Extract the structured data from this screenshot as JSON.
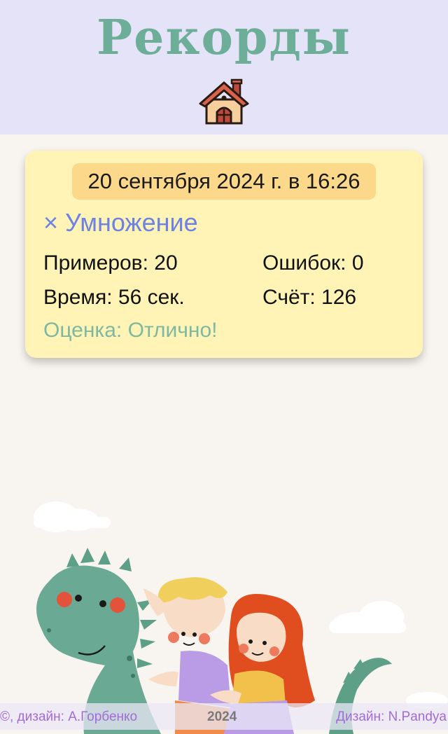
{
  "header": {
    "title": "Рекорды",
    "home_icon": "house-icon"
  },
  "record": {
    "date": "20 сентября 2024 г. в 16:26",
    "operation_symbol": "×",
    "operation_name": "Умножение",
    "examples_label": "Примеров: 20",
    "errors_label": "Ошибок: 0",
    "time_label": "Время: 56 сек.",
    "score_label": "Счёт: 126",
    "grade_label": "Оценка: Отлично!"
  },
  "footer": {
    "left": "©, дизайн:  А.Горбенко",
    "year": "2024",
    "right": "Дизайн:  N.Pandya"
  },
  "colors": {
    "header_bg": "#e5e3f7",
    "title": "#6cae98",
    "card_bg": "#fff3b6",
    "date_chip": "#fcd98a",
    "operation": "#6b82e6",
    "grade": "#7fb8a0",
    "footer_text": "#a36bd8"
  }
}
